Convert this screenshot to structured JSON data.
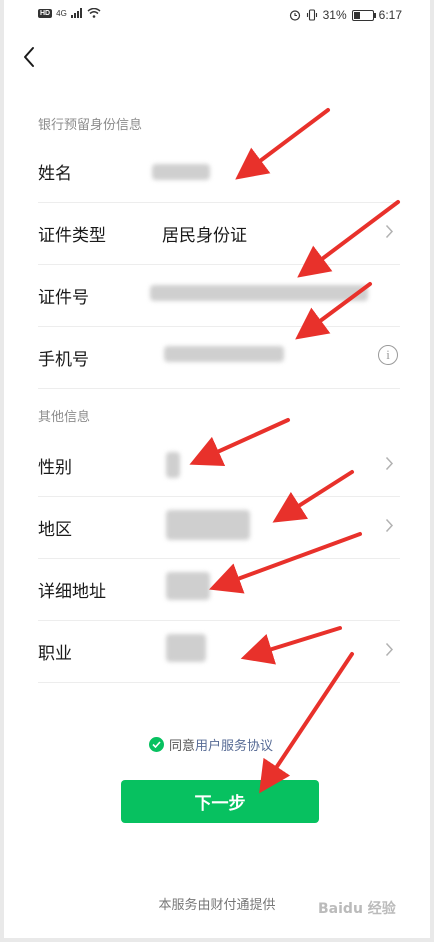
{
  "statusbar": {
    "badge": "HD",
    "network": "4G",
    "battery": "31%",
    "time": "6:17"
  },
  "sections": {
    "bank_info_title": "银行预留身份信息",
    "other_info_title": "其他信息"
  },
  "fields": {
    "name_label": "姓名",
    "id_type_label": "证件类型",
    "id_type_value": "居民身份证",
    "id_number_label": "证件号",
    "phone_label": "手机号",
    "gender_label": "性别",
    "region_label": "地区",
    "address_label": "详细地址",
    "occupation_label": "职业"
  },
  "agreement": {
    "prefix": "同意",
    "link": "用户服务协议"
  },
  "next_button_label": "下一步",
  "footer_text": "本服务由财付通提供",
  "watermark": "Baidu 经验",
  "colors": {
    "primary_green": "#07c160",
    "link_blue": "#576b95",
    "annotation_red": "#e8312b"
  }
}
